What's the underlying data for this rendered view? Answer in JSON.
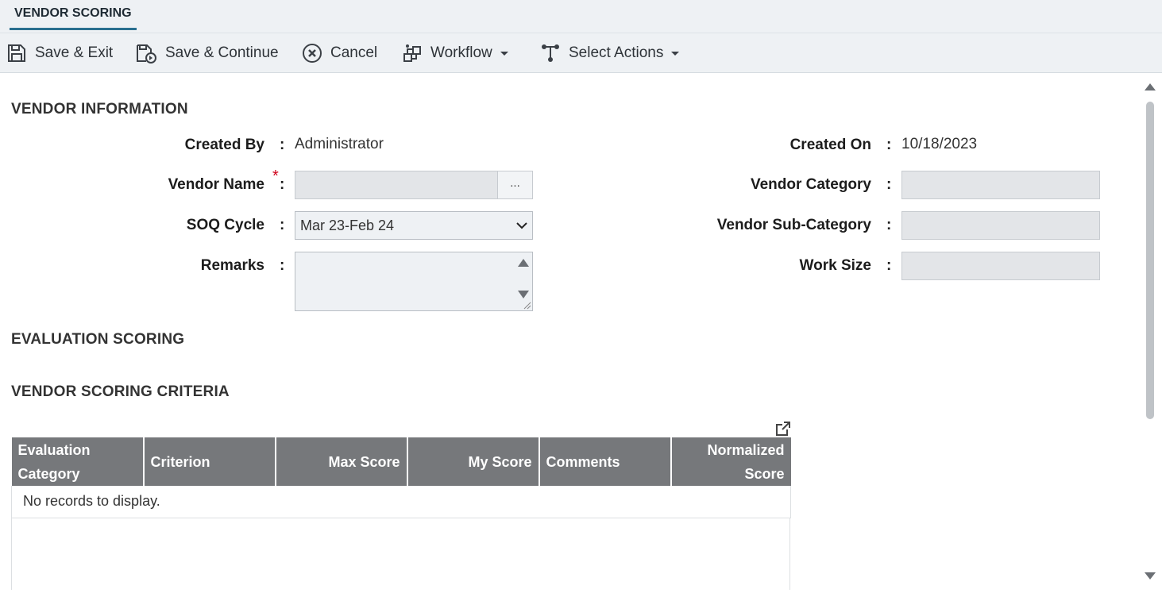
{
  "tab": {
    "label": "VENDOR SCORING"
  },
  "toolbar": {
    "save_exit": "Save & Exit",
    "save_continue": "Save & Continue",
    "cancel": "Cancel",
    "workflow": "Workflow",
    "select_actions": "Select Actions"
  },
  "vendor_info": {
    "title": "VENDOR INFORMATION",
    "created_by_label": "Created By",
    "created_by_value": "Administrator",
    "created_on_label": "Created On",
    "created_on_value": "10/18/2023",
    "vendor_name_label": "Vendor Name",
    "vendor_name_required": "*",
    "vendor_name_value": "",
    "lookup_button": "...",
    "vendor_category_label": "Vendor Category",
    "vendor_category_value": "",
    "soq_cycle_label": "SOQ Cycle",
    "soq_cycle_value": "Mar 23-Feb 24",
    "vendor_subcategory_label": "Vendor Sub-Category",
    "vendor_subcategory_value": "",
    "remarks_label": "Remarks",
    "remarks_value": "",
    "work_size_label": "Work Size",
    "work_size_value": "",
    "colon": ":"
  },
  "evaluation_scoring": {
    "title": "EVALUATION SCORING"
  },
  "criteria": {
    "title": "VENDOR SCORING CRITERIA",
    "columns": {
      "eval_category_1": "Evaluation",
      "eval_category_2": "Category",
      "criterion": "Criterion",
      "max_score": "Max Score",
      "my_score": "My Score",
      "comments": "Comments",
      "normalized_1": "Normalized",
      "normalized_2": "Score"
    },
    "rows": [],
    "empty_message": "No records to display."
  },
  "icons": {
    "save_exit": "save-icon",
    "save_continue": "save-continue-icon",
    "cancel": "cancel-icon",
    "workflow": "workflow-icon",
    "select_actions": "actions-icon",
    "popout": "popout-icon"
  },
  "colors": {
    "accent": "#2a6f8f",
    "header_bg": "#76787b",
    "required": "#d0021b",
    "toolbar_bg": "#eef1f4",
    "field_bg": "#e3e5e8"
  }
}
